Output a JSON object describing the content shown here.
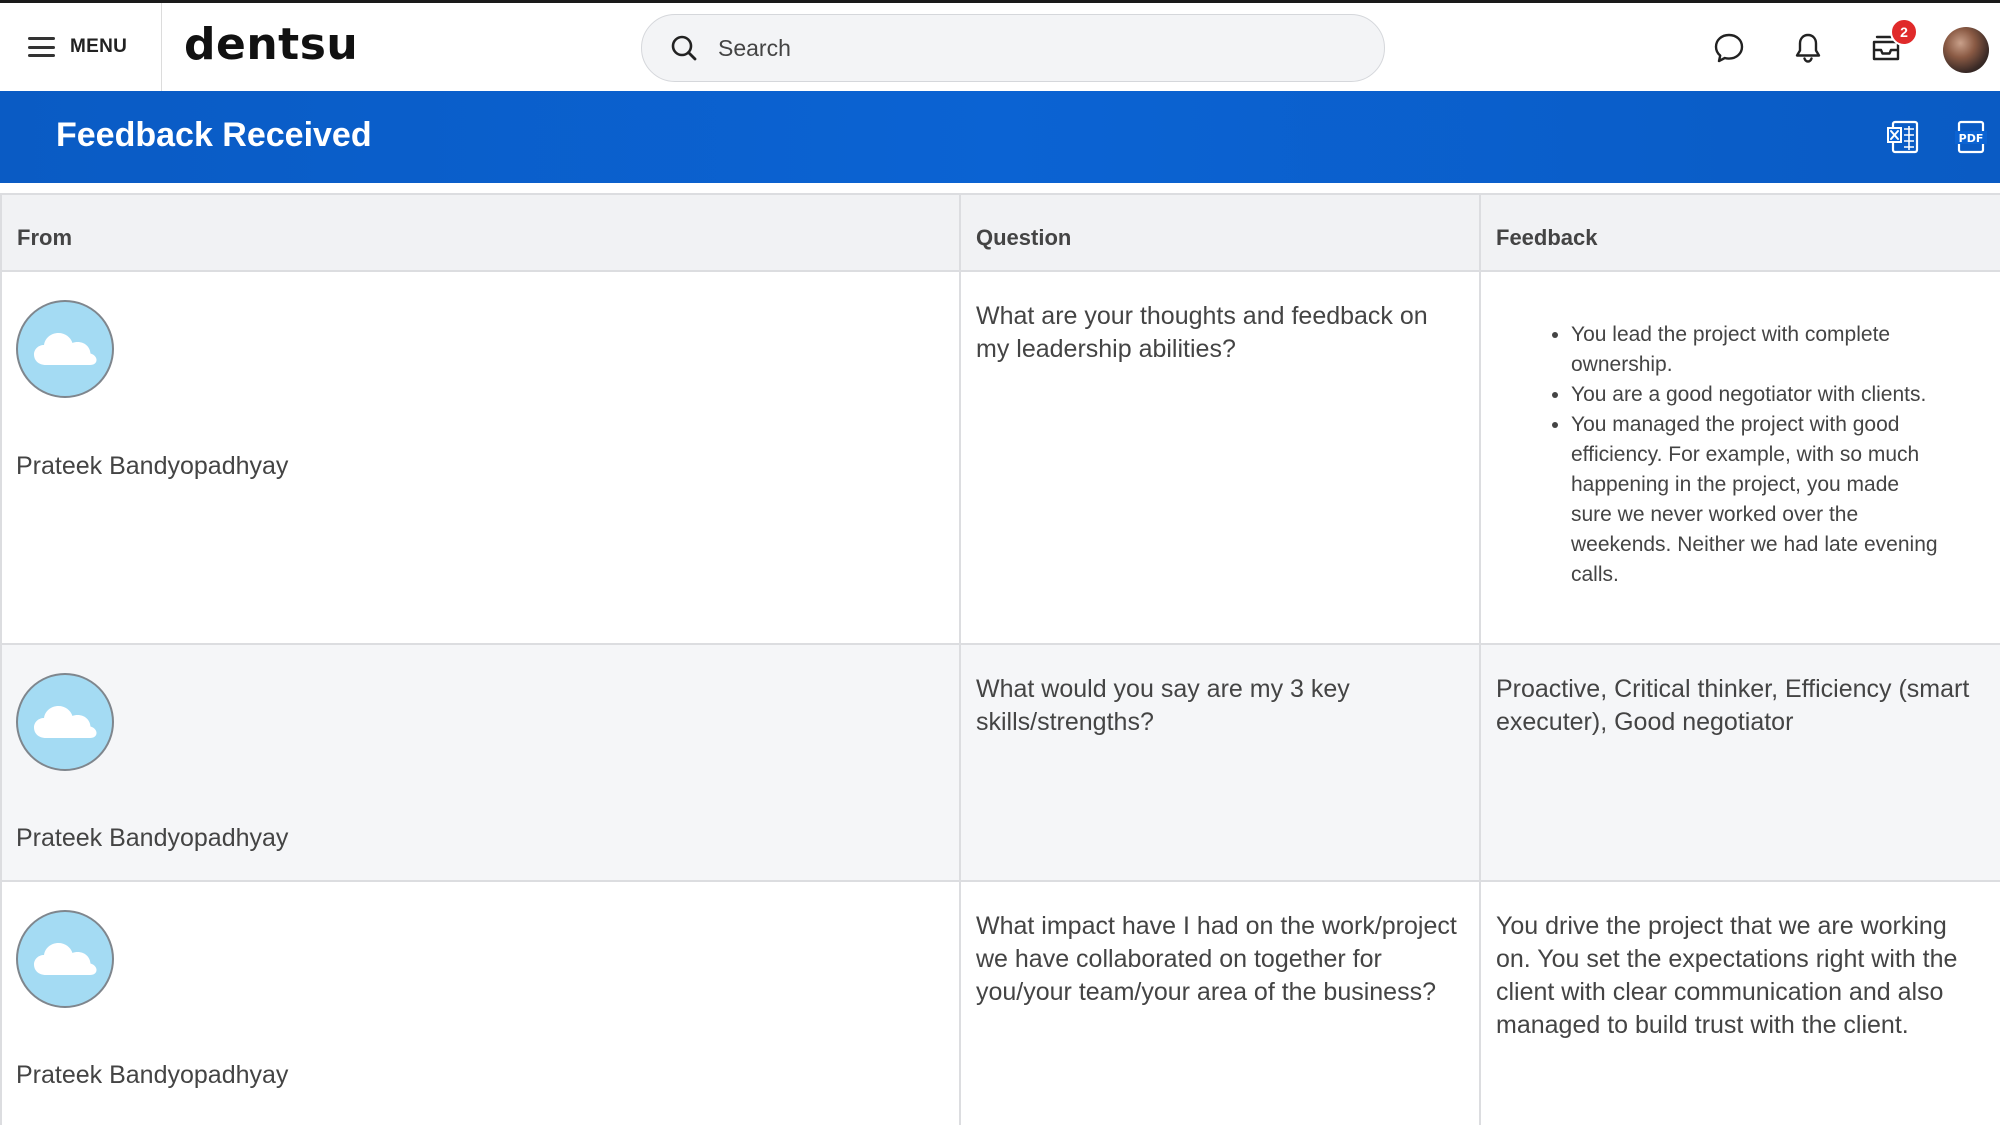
{
  "header": {
    "menu_label": "MENU",
    "logo": "dentsu",
    "search_placeholder": "Search",
    "inbox_badge": "2"
  },
  "page": {
    "title": "Feedback Received"
  },
  "table": {
    "columns": [
      "From",
      "Question",
      "Feedback"
    ],
    "rows": [
      {
        "from": "Prateek Bandyopadhyay",
        "question": "What are your thoughts and feedback on my leadership abilities?",
        "feedback_items": [
          "You lead the project with complete ownership.",
          "You are a good negotiator with clients.",
          "You managed the project with good efficiency. For example, with so much happening in the project, you made sure we never worked over the weekends. Neither we had late evening calls."
        ]
      },
      {
        "from": "Prateek Bandyopadhyay",
        "question": "What would you say are my 3 key skills/strengths?",
        "feedback": "Proactive, Critical thinker, Efficiency (smart executer), Good negotiator"
      },
      {
        "from": "Prateek Bandyopadhyay",
        "question": "What impact have I had on the work/project we have collaborated on together for you/your team/your area of the business?",
        "feedback": "You drive the project that we are working on. You set the expectations right with the client with clear communication and also managed to build trust with the client."
      }
    ]
  },
  "icons": {
    "menu": "hamburger-icon",
    "search": "search-icon",
    "chat": "chat-bubble-icon",
    "notifications": "bell-icon",
    "inbox": "inbox-icon",
    "excel": "export-excel-icon",
    "pdf": "export-pdf-icon",
    "row_avatar": "cloud-avatar-icon"
  },
  "colors": {
    "title_bar": "#0b63d3",
    "badge": "#e02a2a",
    "avatar_bg": "#a4dbf3",
    "header_bg": "#f1f2f4"
  }
}
